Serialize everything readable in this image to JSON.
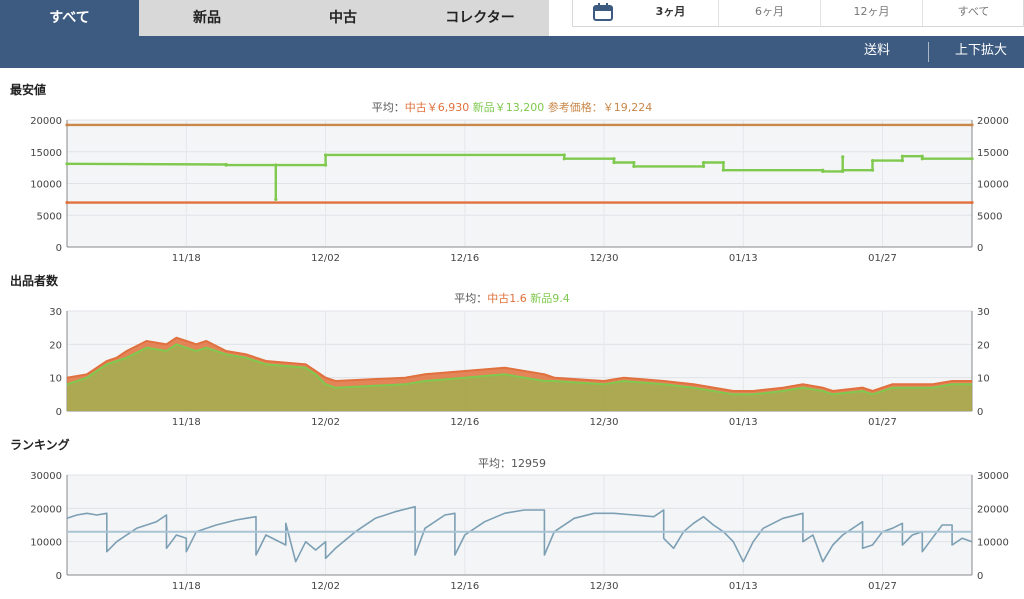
{
  "condition_tabs": {
    "all": "すべて",
    "new": "新品",
    "used": "中古",
    "collector": "コレクター"
  },
  "period": {
    "m3": "3ヶ月",
    "m6": "6ヶ月",
    "m12": "12ヶ月",
    "all": "すべて"
  },
  "toolbar": {
    "shipping": "送料",
    "zoom": "上下拡大"
  },
  "colors": {
    "used": "#e0703d",
    "new": "#7fc94e",
    "reference": "#c9874a",
    "ranking": "#7c9fb4",
    "nav": "#3d5a80"
  },
  "chart_data": [
    {
      "type": "line",
      "title": "最安値",
      "summary": {
        "prefix": "平均：",
        "used_label": "中古￥6,930",
        "new_label": "新品￥13,200",
        "ref_label": "参考価格：￥19,224"
      },
      "x_range": [
        "11/06",
        "02/05"
      ],
      "x_ticks": [
        "11/18",
        "12/02",
        "12/16",
        "12/30",
        "01/13",
        "01/27"
      ],
      "ylim": [
        0,
        20000
      ],
      "y_ticks": [
        "0",
        "5000",
        "10000",
        "15000",
        "20000"
      ],
      "series": [
        {
          "name": "参考価格",
          "color": "#c9874a",
          "points": [
            [
              "11/06",
              19224
            ],
            [
              "02/05",
              19224
            ]
          ]
        },
        {
          "name": "新品",
          "color": "#7fc94e",
          "points": [
            [
              "11/06",
              13100
            ],
            [
              "11/22",
              13000
            ],
            [
              "11/22",
              12900
            ],
            [
              "11/27",
              12900
            ],
            [
              "11/27",
              7500
            ],
            [
              "11/27",
              12900
            ],
            [
              "12/02",
              12900
            ],
            [
              "12/02",
              14500
            ],
            [
              "12/26",
              14500
            ],
            [
              "12/26",
              13900
            ],
            [
              "12/31",
              13900
            ],
            [
              "12/31",
              13300
            ],
            [
              "01/02",
              13300
            ],
            [
              "01/02",
              12700
            ],
            [
              "01/09",
              12700
            ],
            [
              "01/09",
              13300
            ],
            [
              "01/11",
              13300
            ],
            [
              "01/11",
              12100
            ],
            [
              "01/21",
              12100
            ],
            [
              "01/21",
              11900
            ],
            [
              "01/23",
              11900
            ],
            [
              "01/23",
              14200
            ],
            [
              "01/23",
              12100
            ],
            [
              "01/26",
              12100
            ],
            [
              "01/26",
              13600
            ],
            [
              "01/29",
              13600
            ],
            [
              "01/29",
              14300
            ],
            [
              "01/31",
              14300
            ],
            [
              "01/31",
              13900
            ],
            [
              "02/05",
              13900
            ]
          ]
        },
        {
          "name": "中古",
          "color": "#e0703d",
          "points": [
            [
              "11/06",
              7000
            ],
            [
              "02/05",
              7000
            ]
          ]
        }
      ]
    },
    {
      "type": "area",
      "title": "出品者数",
      "summary": {
        "prefix": "平均：",
        "used_label": "中古1.6",
        "new_label": "新品9.4"
      },
      "x_range": [
        "11/06",
        "02/05"
      ],
      "x_ticks": [
        "11/18",
        "12/02",
        "12/16",
        "12/30",
        "01/13",
        "01/27"
      ],
      "ylim": [
        0,
        30
      ],
      "y_ticks": [
        "0",
        "10",
        "20",
        "30"
      ],
      "series": [
        {
          "name": "中古",
          "color": "#e0703d",
          "points": [
            [
              "11/06",
              10
            ],
            [
              "11/08",
              11
            ],
            [
              "11/09",
              13
            ],
            [
              "11/10",
              15
            ],
            [
              "11/11",
              16
            ],
            [
              "11/12",
              18
            ],
            [
              "11/14",
              21
            ],
            [
              "11/16",
              20
            ],
            [
              "11/17",
              22
            ],
            [
              "11/18",
              21
            ],
            [
              "11/19",
              20
            ],
            [
              "11/20",
              21
            ],
            [
              "11/22",
              18
            ],
            [
              "11/24",
              17
            ],
            [
              "11/26",
              15
            ],
            [
              "11/30",
              14
            ],
            [
              "12/01",
              12
            ],
            [
              "12/02",
              10
            ],
            [
              "12/03",
              9
            ],
            [
              "12/10",
              10
            ],
            [
              "12/12",
              11
            ],
            [
              "12/16",
              12
            ],
            [
              "12/20",
              13
            ],
            [
              "12/24",
              11
            ],
            [
              "12/25",
              10
            ],
            [
              "12/30",
              9
            ],
            [
              "01/01",
              10
            ],
            [
              "01/05",
              9
            ],
            [
              "01/08",
              8
            ],
            [
              "01/12",
              6
            ],
            [
              "01/14",
              6
            ],
            [
              "01/17",
              7
            ],
            [
              "01/19",
              8
            ],
            [
              "01/21",
              7
            ],
            [
              "01/22",
              6
            ],
            [
              "01/25",
              7
            ],
            [
              "01/26",
              6
            ],
            [
              "01/28",
              8
            ],
            [
              "02/01",
              8
            ],
            [
              "02/03",
              9
            ],
            [
              "02/05",
              9
            ]
          ]
        },
        {
          "name": "新品",
          "color": "#7fc94e",
          "points": [
            [
              "11/06",
              8
            ],
            [
              "11/08",
              10
            ],
            [
              "11/09",
              12
            ],
            [
              "11/10",
              14
            ],
            [
              "11/11",
              15
            ],
            [
              "11/12",
              16
            ],
            [
              "11/14",
              19
            ],
            [
              "11/16",
              18
            ],
            [
              "11/17",
              20
            ],
            [
              "11/18",
              19
            ],
            [
              "11/19",
              18
            ],
            [
              "11/20",
              19
            ],
            [
              "11/22",
              17
            ],
            [
              "11/24",
              16
            ],
            [
              "11/26",
              14
            ],
            [
              "11/30",
              13
            ],
            [
              "12/01",
              11
            ],
            [
              "12/02",
              8
            ],
            [
              "12/03",
              7
            ],
            [
              "12/10",
              8
            ],
            [
              "12/12",
              9
            ],
            [
              "12/16",
              10
            ],
            [
              "12/20",
              11
            ],
            [
              "12/24",
              9
            ],
            [
              "12/25",
              9
            ],
            [
              "12/30",
              8
            ],
            [
              "01/01",
              9
            ],
            [
              "01/05",
              8
            ],
            [
              "01/08",
              7
            ],
            [
              "01/12",
              5
            ],
            [
              "01/14",
              5
            ],
            [
              "01/17",
              6
            ],
            [
              "01/19",
              7
            ],
            [
              "01/21",
              6
            ],
            [
              "01/22",
              5
            ],
            [
              "01/25",
              6
            ],
            [
              "01/26",
              5
            ],
            [
              "01/28",
              7
            ],
            [
              "02/01",
              7
            ],
            [
              "02/03",
              8
            ],
            [
              "02/05",
              8
            ]
          ]
        }
      ]
    },
    {
      "type": "line",
      "title": "ランキング",
      "summary": {
        "prefix": "平均：",
        "avg_label": "12959",
        "avg_value": 12959
      },
      "x_range": [
        "11/06",
        "02/05"
      ],
      "x_ticks": [
        "11/18",
        "12/02",
        "12/16",
        "12/30",
        "01/13",
        "01/27"
      ],
      "ylim": [
        0,
        30000
      ],
      "y_ticks": [
        "0",
        "10000",
        "20000",
        "30000"
      ],
      "series": [
        {
          "name": "ランキング",
          "color": "#7c9fb4",
          "points": [
            [
              "11/06",
              17000
            ],
            [
              "11/07",
              18000
            ],
            [
              "11/08",
              18500
            ],
            [
              "11/09",
              18000
            ],
            [
              "11/10",
              18500
            ],
            [
              "11/10",
              7000
            ],
            [
              "11/11",
              10000
            ],
            [
              "11/13",
              14000
            ],
            [
              "11/15",
              16000
            ],
            [
              "11/16",
              18000
            ],
            [
              "11/16",
              8000
            ],
            [
              "11/17",
              12000
            ],
            [
              "11/18",
              11000
            ],
            [
              "11/18",
              7000
            ],
            [
              "11/19",
              13000
            ],
            [
              "11/21",
              15000
            ],
            [
              "11/23",
              16500
            ],
            [
              "11/24",
              17000
            ],
            [
              "11/25",
              17500
            ],
            [
              "11/25",
              6000
            ],
            [
              "11/26",
              12000
            ],
            [
              "11/28",
              9000
            ],
            [
              "11/28",
              15500
            ],
            [
              "11/29",
              4000
            ],
            [
              "11/30",
              10000
            ],
            [
              "12/01",
              7500
            ],
            [
              "12/02",
              10000
            ],
            [
              "12/02",
              5000
            ],
            [
              "12/03",
              8000
            ],
            [
              "12/05",
              13000
            ],
            [
              "12/07",
              17000
            ],
            [
              "12/09",
              19000
            ],
            [
              "12/11",
              20500
            ],
            [
              "12/11",
              6000
            ],
            [
              "12/12",
              14000
            ],
            [
              "12/14",
              18000
            ],
            [
              "12/15",
              18500
            ],
            [
              "12/15",
              6000
            ],
            [
              "12/16",
              12000
            ],
            [
              "12/18",
              16000
            ],
            [
              "12/20",
              18500
            ],
            [
              "12/22",
              19500
            ],
            [
              "12/24",
              19500
            ],
            [
              "12/24",
              6000
            ],
            [
              "12/25",
              13000
            ],
            [
              "12/27",
              17000
            ],
            [
              "12/29",
              18500
            ],
            [
              "12/31",
              18500
            ],
            [
              "01/02",
              18000
            ],
            [
              "01/04",
              17500
            ],
            [
              "01/05",
              19500
            ],
            [
              "01/05",
              11000
            ],
            [
              "01/06",
              8000
            ],
            [
              "01/07",
              13000
            ],
            [
              "01/08",
              15500
            ],
            [
              "01/09",
              17500
            ],
            [
              "01/10",
              15000
            ],
            [
              "01/11",
              13000
            ],
            [
              "01/12",
              10000
            ],
            [
              "01/13",
              4000
            ],
            [
              "01/14",
              10000
            ],
            [
              "01/15",
              14000
            ],
            [
              "01/17",
              17000
            ],
            [
              "01/19",
              18500
            ],
            [
              "01/19",
              10000
            ],
            [
              "01/20",
              12000
            ],
            [
              "01/21",
              4000
            ],
            [
              "01/22",
              9000
            ],
            [
              "01/23",
              12000
            ],
            [
              "01/25",
              16000
            ],
            [
              "01/25",
              8000
            ],
            [
              "01/26",
              9000
            ],
            [
              "01/27",
              13000
            ],
            [
              "01/28",
              14000
            ],
            [
              "01/29",
              15500
            ],
            [
              "01/29",
              9000
            ],
            [
              "01/30",
              12000
            ],
            [
              "01/31",
              13000
            ],
            [
              "01/31",
              7000
            ],
            [
              "02/01",
              11000
            ],
            [
              "02/02",
              15000
            ],
            [
              "02/03",
              15000
            ],
            [
              "02/03",
              9000
            ],
            [
              "02/04",
              11000
            ],
            [
              "02/05",
              10000
            ]
          ]
        }
      ]
    }
  ]
}
